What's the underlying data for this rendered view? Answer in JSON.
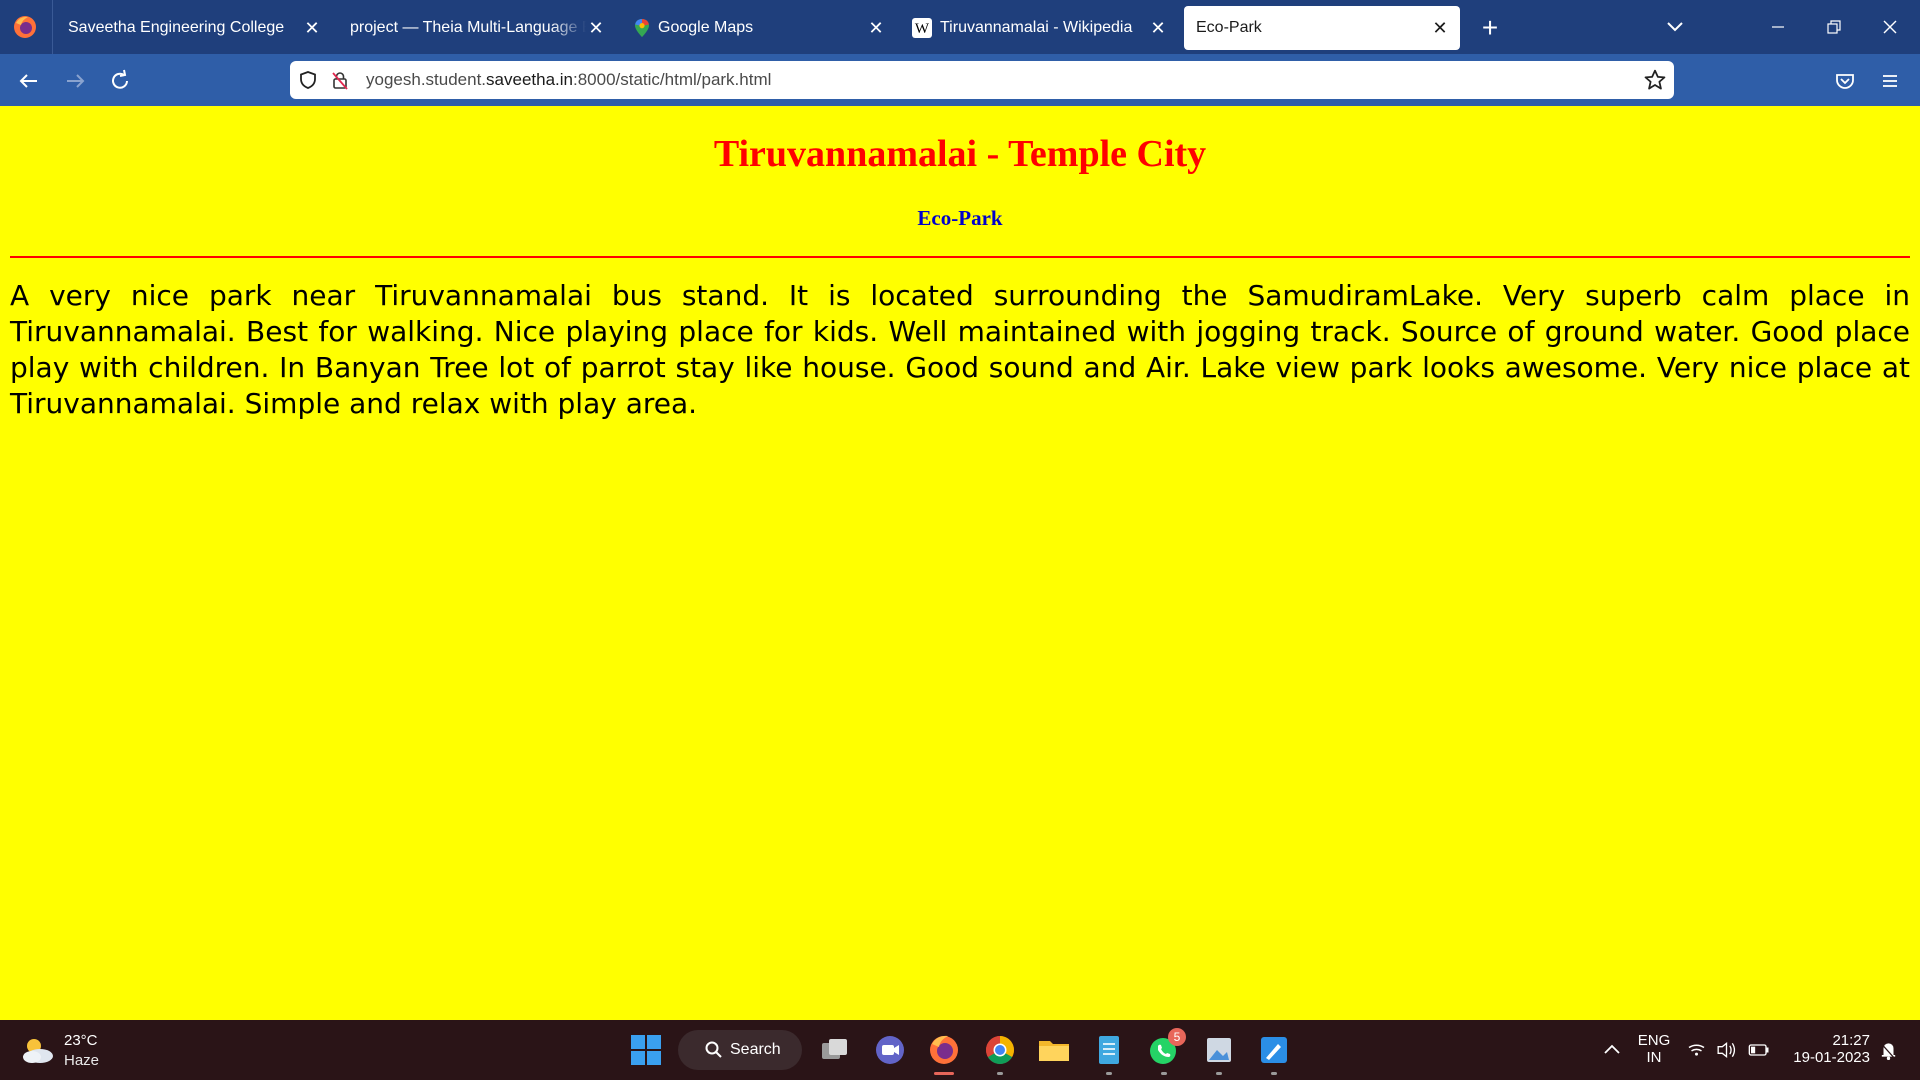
{
  "browser": {
    "tabs": [
      {
        "title": "Saveetha Engineering College",
        "icon": "none",
        "active": false
      },
      {
        "title": "project — Theia Multi-Language Ex",
        "icon": "none",
        "active": false
      },
      {
        "title": "Google Maps",
        "icon": "maps-pin-icon",
        "active": false
      },
      {
        "title": "Tiruvannamalai - Wikipedia",
        "icon": "wikipedia-icon",
        "active": false
      },
      {
        "title": "Eco-Park",
        "icon": "none",
        "active": true
      }
    ],
    "close_glyph": "✕",
    "new_tab_glyph": "+",
    "url": {
      "prefix": "yogesh.student.",
      "host": "saveetha.in",
      "suffix": ":8000/static/html/park.html"
    }
  },
  "page": {
    "heading": "Tiruvannamalai - Temple City",
    "subheading": "Eco-Park",
    "paragraph": "A very nice park near Tiruvannamalai bus stand. It is located surrounding the SamudiramLake. Very superb calm place in Tiruvannamalai. Best for walking. Nice playing place for kids. Well maintained with jogging track. Source of ground water. Good place play with children. In Banyan Tree lot of parrot stay like house. Good sound and Air. Lake view park looks awesome. Very nice place at Tiruvannamalai. Simple and relax with play area.",
    "colors": {
      "background": "#ffff00",
      "heading": "#ff0000",
      "subheading": "#0000cc",
      "rule": "#ff0000"
    }
  },
  "taskbar": {
    "weather": {
      "temp": "23°C",
      "desc": "Haze"
    },
    "search_label": "Search",
    "whatsapp_badge": "5",
    "lang_top": "ENG",
    "lang_bottom": "IN",
    "time": "21:27",
    "date": "19-01-2023"
  }
}
